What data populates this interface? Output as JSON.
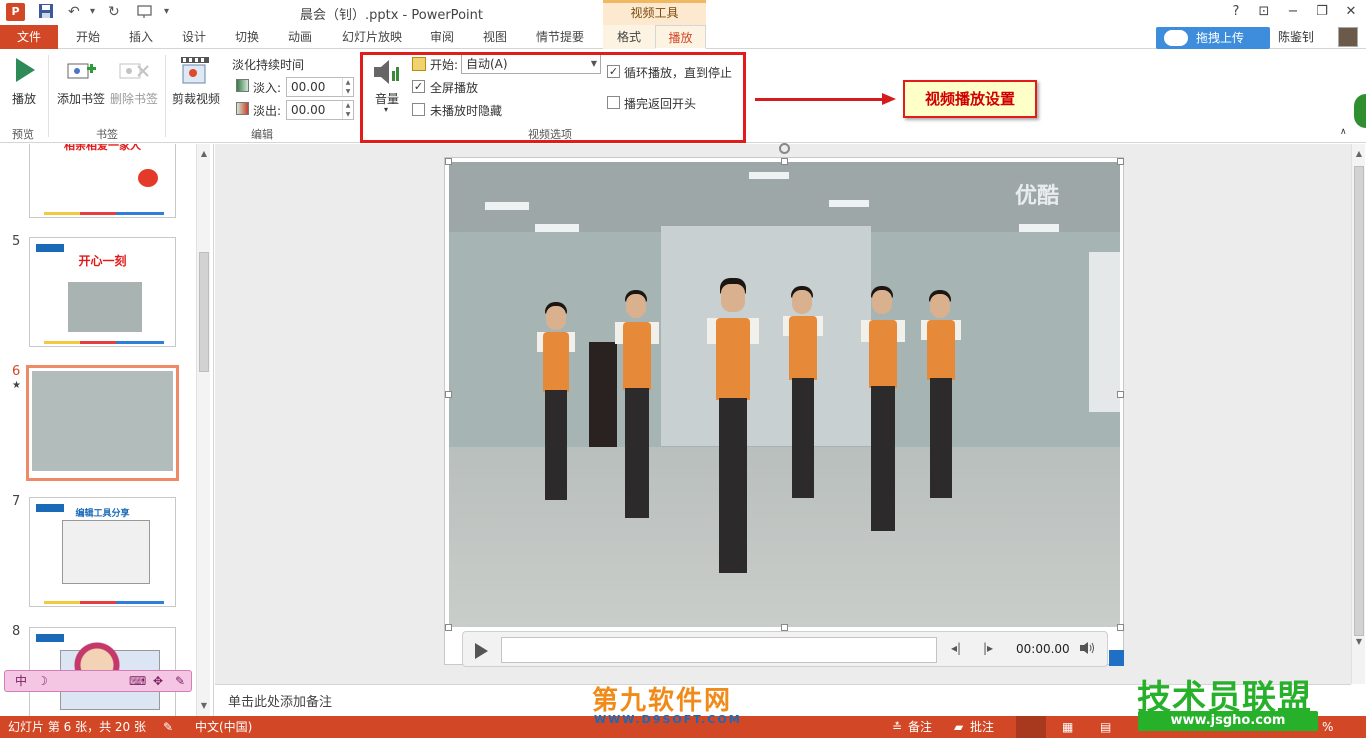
{
  "titlebar": {
    "title": "晨会（钊）.pptx - PowerPoint",
    "app_logo": "P",
    "context_group": "视频工具",
    "help": "?",
    "ribbon_display": "⊡",
    "minimize": "−",
    "restore": "❐",
    "close": "✕"
  },
  "quick_access": {
    "save_icon": "save-icon",
    "undo": "↶",
    "redo": "↻",
    "more": "▾"
  },
  "tabs": {
    "file": "文件",
    "items": [
      "开始",
      "插入",
      "设计",
      "切换",
      "动画",
      "幻灯片放映",
      "审阅",
      "视图",
      "情节提要",
      "格式",
      "播放"
    ],
    "active": "播放",
    "upload_button": "拖拽上传",
    "user_name": "陈鉴钊"
  },
  "ribbon": {
    "preview": {
      "play_label": "播放",
      "group": "预览"
    },
    "bookmarks": {
      "add_label": "添加书签",
      "remove_label": "删除书签",
      "group": "书签"
    },
    "editing": {
      "trim_label": "剪裁视频",
      "fade_duration_label": "淡化持续时间",
      "fade_in_label": "淡入:",
      "fade_in_value": "00.00",
      "fade_out_label": "淡出:",
      "fade_out_value": "00.00",
      "group": "编辑"
    },
    "video_options": {
      "volume_label": "音量",
      "start_label": "开始:",
      "start_value": "自动(A)",
      "fullscreen_label": "全屏播放",
      "fullscreen_checked": "✓",
      "hide_label": "未播放时隐藏",
      "loop_label": "循环播放，直到停止",
      "loop_checked": "✓",
      "rewind_label": "播完返回开头",
      "group": "视频选项"
    }
  },
  "callout": {
    "text": "视频播放设置",
    "color": "#e21b1b"
  },
  "slides": [
    {
      "num": "",
      "title": "相亲相爱一家人"
    },
    {
      "num": "5",
      "title": "开心一刻"
    },
    {
      "num": "6",
      "star": "★",
      "title": ""
    },
    {
      "num": "7",
      "title": "编辑工具分享"
    },
    {
      "num": "8",
      "title": ""
    }
  ],
  "video": {
    "watermark": "优酷",
    "time": "00:00.00"
  },
  "notes": {
    "placeholder": "单击此处添加备注"
  },
  "statusbar": {
    "slide_info": "幻灯片 第 6 张，共 20 张",
    "language": "中文(中国)",
    "notes": "备注",
    "comments": "批注",
    "zoom": "%"
  },
  "overlays": {
    "ime_text": "中",
    "watermark_left": "第九软件网",
    "watermark_left_sub": "WWW.D9SOFT.COM",
    "watermark_right": "技术员联盟",
    "watermark_right_sub": "www.jsgho.com"
  },
  "colors": {
    "accent": "#d24726",
    "video_tools": "#fde9cf"
  }
}
